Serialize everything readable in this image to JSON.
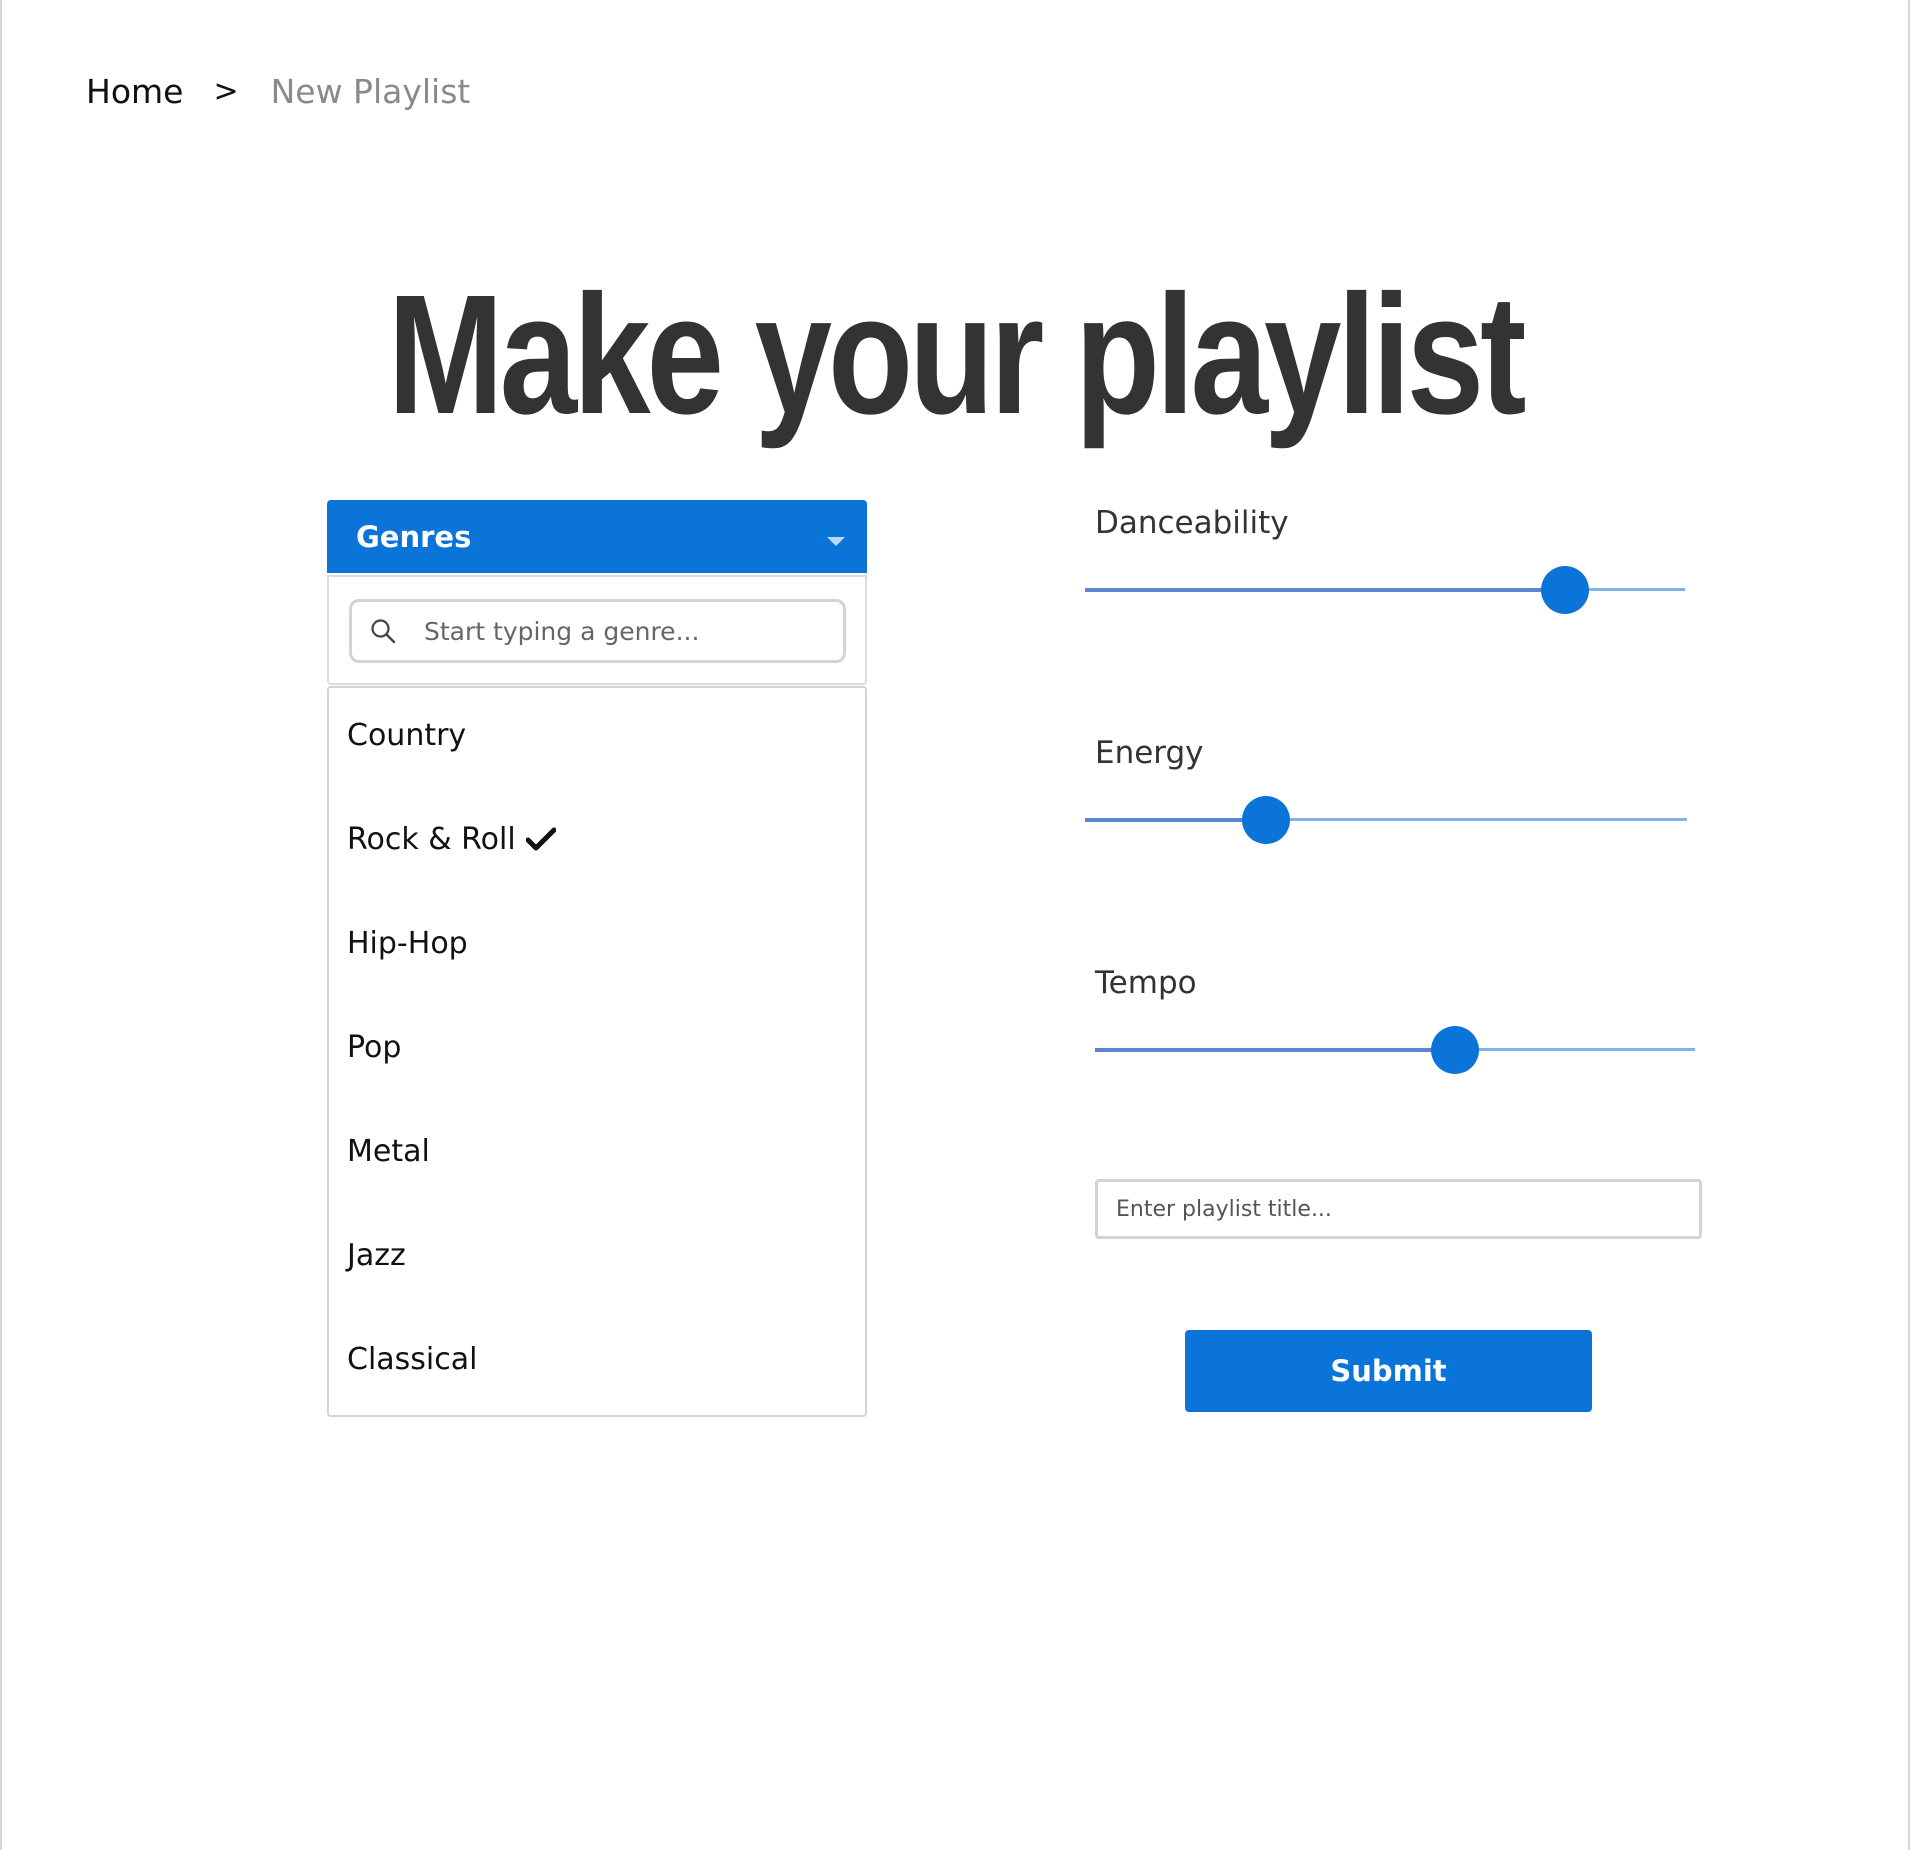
{
  "breadcrumb": {
    "home": "Home",
    "separator": ">",
    "current": "New Playlist"
  },
  "page_title": "Make your playlist",
  "genres": {
    "header_label": "Genres",
    "search_placeholder": "Start typing a genre...",
    "items": [
      {
        "label": "Country",
        "selected": false
      },
      {
        "label": "Rock & Roll",
        "selected": true
      },
      {
        "label": "Hip-Hop",
        "selected": false
      },
      {
        "label": "Pop",
        "selected": false
      },
      {
        "label": "Metal",
        "selected": false
      },
      {
        "label": "Jazz",
        "selected": false
      },
      {
        "label": "Classical",
        "selected": false
      }
    ]
  },
  "sliders": [
    {
      "label": "Danceability",
      "value": 0.8
    },
    {
      "label": "Energy",
      "value": 0.3
    },
    {
      "label": "Tempo",
      "value": 0.6
    }
  ],
  "playlist_title": {
    "value": "",
    "placeholder": "Enter playlist title..."
  },
  "submit_label": "Submit",
  "colors": {
    "accent": "#0a74d9",
    "title_text": "#333333",
    "breadcrumb_current": "#8a8a8a"
  }
}
